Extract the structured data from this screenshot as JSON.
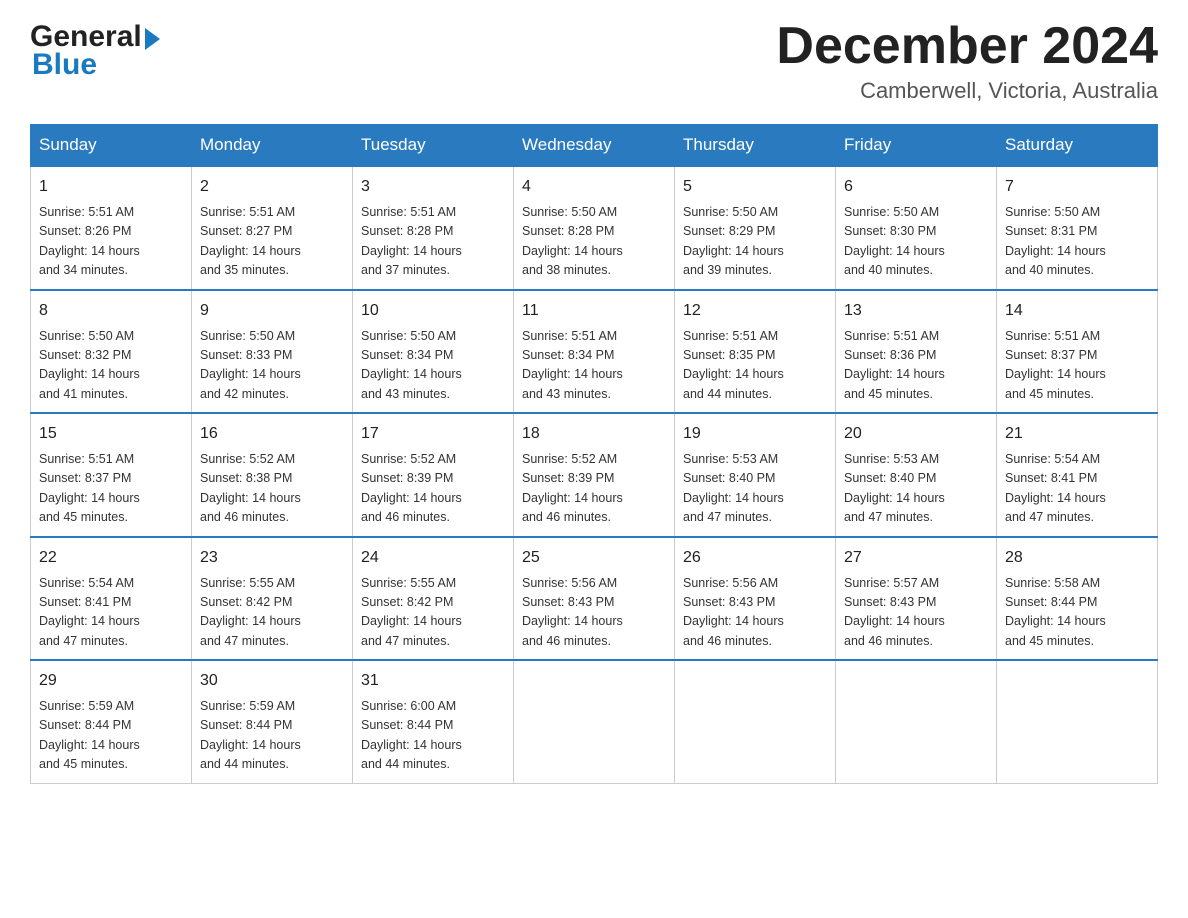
{
  "logo": {
    "general": "General",
    "blue": "Blue",
    "triangle_alt": "arrow icon"
  },
  "title": {
    "month_year": "December 2024",
    "location": "Camberwell, Victoria, Australia"
  },
  "headers": [
    "Sunday",
    "Monday",
    "Tuesday",
    "Wednesday",
    "Thursday",
    "Friday",
    "Saturday"
  ],
  "weeks": [
    [
      {
        "day": "1",
        "sunrise": "5:51 AM",
        "sunset": "8:26 PM",
        "daylight": "14 hours and 34 minutes."
      },
      {
        "day": "2",
        "sunrise": "5:51 AM",
        "sunset": "8:27 PM",
        "daylight": "14 hours and 35 minutes."
      },
      {
        "day": "3",
        "sunrise": "5:51 AM",
        "sunset": "8:28 PM",
        "daylight": "14 hours and 37 minutes."
      },
      {
        "day": "4",
        "sunrise": "5:50 AM",
        "sunset": "8:28 PM",
        "daylight": "14 hours and 38 minutes."
      },
      {
        "day": "5",
        "sunrise": "5:50 AM",
        "sunset": "8:29 PM",
        "daylight": "14 hours and 39 minutes."
      },
      {
        "day": "6",
        "sunrise": "5:50 AM",
        "sunset": "8:30 PM",
        "daylight": "14 hours and 40 minutes."
      },
      {
        "day": "7",
        "sunrise": "5:50 AM",
        "sunset": "8:31 PM",
        "daylight": "14 hours and 40 minutes."
      }
    ],
    [
      {
        "day": "8",
        "sunrise": "5:50 AM",
        "sunset": "8:32 PM",
        "daylight": "14 hours and 41 minutes."
      },
      {
        "day": "9",
        "sunrise": "5:50 AM",
        "sunset": "8:33 PM",
        "daylight": "14 hours and 42 minutes."
      },
      {
        "day": "10",
        "sunrise": "5:50 AM",
        "sunset": "8:34 PM",
        "daylight": "14 hours and 43 minutes."
      },
      {
        "day": "11",
        "sunrise": "5:51 AM",
        "sunset": "8:34 PM",
        "daylight": "14 hours and 43 minutes."
      },
      {
        "day": "12",
        "sunrise": "5:51 AM",
        "sunset": "8:35 PM",
        "daylight": "14 hours and 44 minutes."
      },
      {
        "day": "13",
        "sunrise": "5:51 AM",
        "sunset": "8:36 PM",
        "daylight": "14 hours and 45 minutes."
      },
      {
        "day": "14",
        "sunrise": "5:51 AM",
        "sunset": "8:37 PM",
        "daylight": "14 hours and 45 minutes."
      }
    ],
    [
      {
        "day": "15",
        "sunrise": "5:51 AM",
        "sunset": "8:37 PM",
        "daylight": "14 hours and 45 minutes."
      },
      {
        "day": "16",
        "sunrise": "5:52 AM",
        "sunset": "8:38 PM",
        "daylight": "14 hours and 46 minutes."
      },
      {
        "day": "17",
        "sunrise": "5:52 AM",
        "sunset": "8:39 PM",
        "daylight": "14 hours and 46 minutes."
      },
      {
        "day": "18",
        "sunrise": "5:52 AM",
        "sunset": "8:39 PM",
        "daylight": "14 hours and 46 minutes."
      },
      {
        "day": "19",
        "sunrise": "5:53 AM",
        "sunset": "8:40 PM",
        "daylight": "14 hours and 47 minutes."
      },
      {
        "day": "20",
        "sunrise": "5:53 AM",
        "sunset": "8:40 PM",
        "daylight": "14 hours and 47 minutes."
      },
      {
        "day": "21",
        "sunrise": "5:54 AM",
        "sunset": "8:41 PM",
        "daylight": "14 hours and 47 minutes."
      }
    ],
    [
      {
        "day": "22",
        "sunrise": "5:54 AM",
        "sunset": "8:41 PM",
        "daylight": "14 hours and 47 minutes."
      },
      {
        "day": "23",
        "sunrise": "5:55 AM",
        "sunset": "8:42 PM",
        "daylight": "14 hours and 47 minutes."
      },
      {
        "day": "24",
        "sunrise": "5:55 AM",
        "sunset": "8:42 PM",
        "daylight": "14 hours and 47 minutes."
      },
      {
        "day": "25",
        "sunrise": "5:56 AM",
        "sunset": "8:43 PM",
        "daylight": "14 hours and 46 minutes."
      },
      {
        "day": "26",
        "sunrise": "5:56 AM",
        "sunset": "8:43 PM",
        "daylight": "14 hours and 46 minutes."
      },
      {
        "day": "27",
        "sunrise": "5:57 AM",
        "sunset": "8:43 PM",
        "daylight": "14 hours and 46 minutes."
      },
      {
        "day": "28",
        "sunrise": "5:58 AM",
        "sunset": "8:44 PM",
        "daylight": "14 hours and 45 minutes."
      }
    ],
    [
      {
        "day": "29",
        "sunrise": "5:59 AM",
        "sunset": "8:44 PM",
        "daylight": "14 hours and 45 minutes."
      },
      {
        "day": "30",
        "sunrise": "5:59 AM",
        "sunset": "8:44 PM",
        "daylight": "14 hours and 44 minutes."
      },
      {
        "day": "31",
        "sunrise": "6:00 AM",
        "sunset": "8:44 PM",
        "daylight": "14 hours and 44 minutes."
      },
      null,
      null,
      null,
      null
    ]
  ],
  "labels": {
    "sunrise": "Sunrise:",
    "sunset": "Sunset:",
    "daylight": "Daylight:"
  }
}
